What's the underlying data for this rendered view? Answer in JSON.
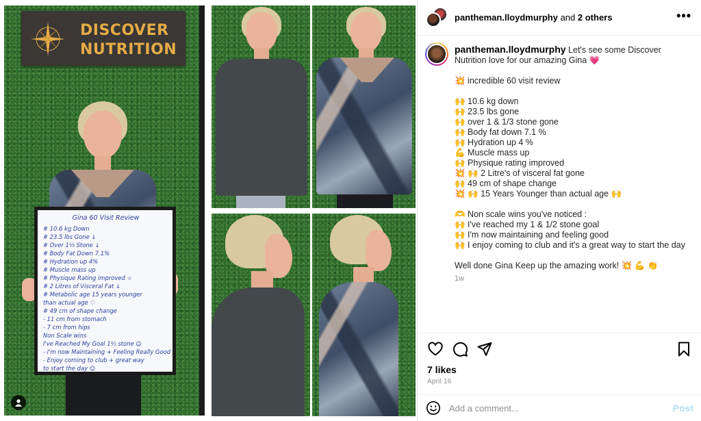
{
  "media": {
    "sign": {
      "line1": "DISCOVER",
      "line2": "NUTRITION"
    },
    "whiteboard": {
      "title": "Gina 60 Visit Review",
      "lines": [
        "# 10.6 kg Down",
        "# 23.5 lbs Gone ↓",
        "# Over 1⅓ Stone ↓",
        "# Body Fat Down 7.1%",
        "# Hydration up 4%",
        "# Muscle mass up",
        "# Physique Rating improved ☆",
        "# 2 Litres of Visceral Fat ↓",
        "# Metabolic age 15 years younger",
        "   than actual age ♡",
        "# 49 cm of shape change",
        "  - 11 cm from stomach",
        "  - 7 cm from hips",
        "Non Scale wins",
        "I've Reached My Goal 1½ stone ☺",
        "- I'm now Maintaining + Feeling Really Good",
        "- Enjoy coming to club + great way",
        "  to start the day ☺"
      ]
    }
  },
  "header": {
    "username": "pantheman.lloydmurphy",
    "connector": " and ",
    "others": "2 others",
    "more_label": "•••"
  },
  "caption": {
    "username": "pantheman.lloydmurphy",
    "lines": [
      " Let's see some Discover",
      "Nutrition love for our amazing Gina 💗",
      "",
      "💥 incredible 60 visit review",
      "",
      "🙌 10.6 kg down",
      "🙌 23.5 lbs gone",
      "🙌 over 1 & 1/3 stone gone",
      "🙌 Body fat down 7.1 %",
      "🙌 Hydration up 4 %",
      "💪 Muscle mass up",
      "🙌 Physique rating improved",
      "💥 🙌 2 Litre's of visceral fat gone",
      "🙌 49 cm of shape change",
      "💥 🙌 15 Years Younger than actual age 🙌",
      "",
      "🫶 Non scale wins you've noticed :",
      "🙌 I've reached my 1 & 1/2 stone goal",
      "🙌 I'm now maintaining and feeling good",
      "🙌 I enjoy coming to club and it's a great way to start the day",
      "",
      "Well done Gina Keep up the amazing work! 💥 💪 👏"
    ],
    "time_ago": "1w"
  },
  "actions": {
    "likes": "7 likes",
    "date": "April 16"
  },
  "comment": {
    "placeholder": "Add a comment...",
    "post_label": "Post"
  },
  "colors": {
    "post_button": "#b2dffc",
    "secondary_text": "#8e8e8e",
    "wall_green": "#2f6a2f",
    "sign_gold": "#e5ab47"
  },
  "icons": [
    "heart-icon",
    "comment-icon",
    "share-icon",
    "bookmark-icon",
    "emoji-icon",
    "more-icon",
    "user-tag-icon",
    "compass-icon"
  ]
}
